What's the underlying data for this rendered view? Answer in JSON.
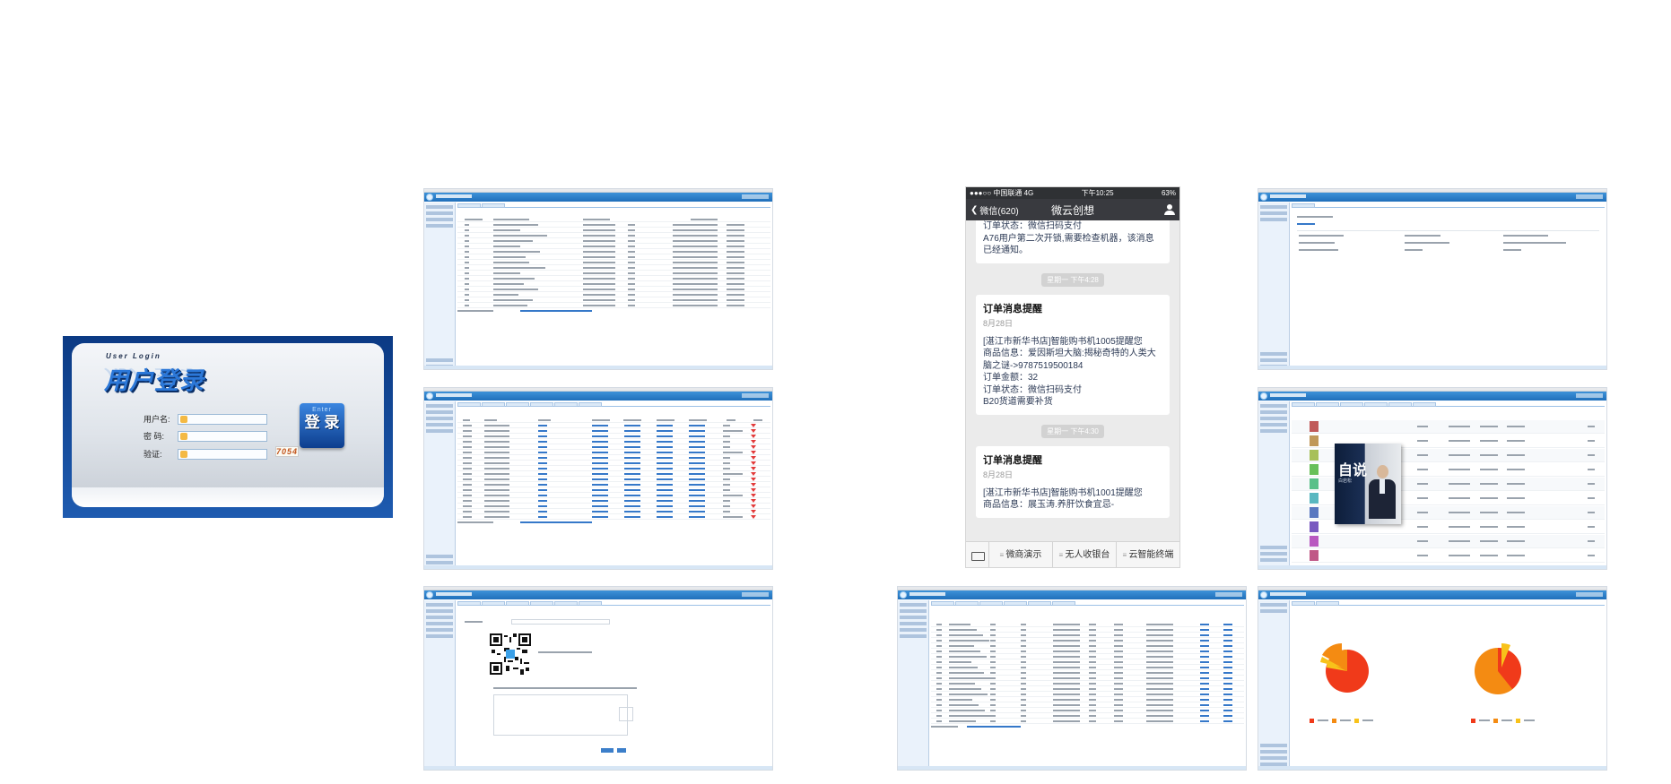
{
  "login": {
    "title_en": "User Login",
    "title_cn": "用户登录",
    "username_label": "用户名:",
    "password_label": "密 码:",
    "captcha_label": "验证:",
    "captcha_value": "7054",
    "enter_en": "Enter",
    "enter_cn": "登 录"
  },
  "phone": {
    "status": {
      "carrier": "●●●○○ 中国联通  4G",
      "time": "下午10:25",
      "battery": "63%"
    },
    "nav": {
      "back_label": "微信(620)",
      "title": "微云创想"
    },
    "partial_card": {
      "lines": [
        "订单状态：微信扫码支付",
        "A76用户第二次开锁,需要检查机器，该消息已经通知。"
      ]
    },
    "timestamps": [
      "星期一 下午4:28",
      "星期一 下午4:30"
    ],
    "cards": [
      {
        "title": "订单消息提醒",
        "date": "8月28日",
        "lines": [
          "[湛江市新华书店]智能购书机1005提醒您",
          "商品信息：爱因斯坦大脑:揭秘奇特的人类大脑之谜->9787519500184",
          "订单金额：32",
          "订单状态：微信扫码支付",
          "B20货道需要补货"
        ]
      },
      {
        "title": "订单消息提醒",
        "date": "8月28日",
        "lines": [
          "[湛江市新华书店]智能购书机1001提醒您",
          "商品信息：展玉涛.养肝饮食宜忌-"
        ]
      }
    ],
    "bottom_menu": [
      "微商演示",
      "无人收银台",
      "云智能终端"
    ]
  },
  "book_cover": {
    "title": "自说",
    "subtitle": "白岩松"
  },
  "colors": {
    "admin_header": "#2a7fc9",
    "pie_red": "#f03a1a",
    "pie_orange": "#f48b12",
    "pie_yellow": "#f8c21a",
    "wechat_nav": "#393a3f"
  }
}
